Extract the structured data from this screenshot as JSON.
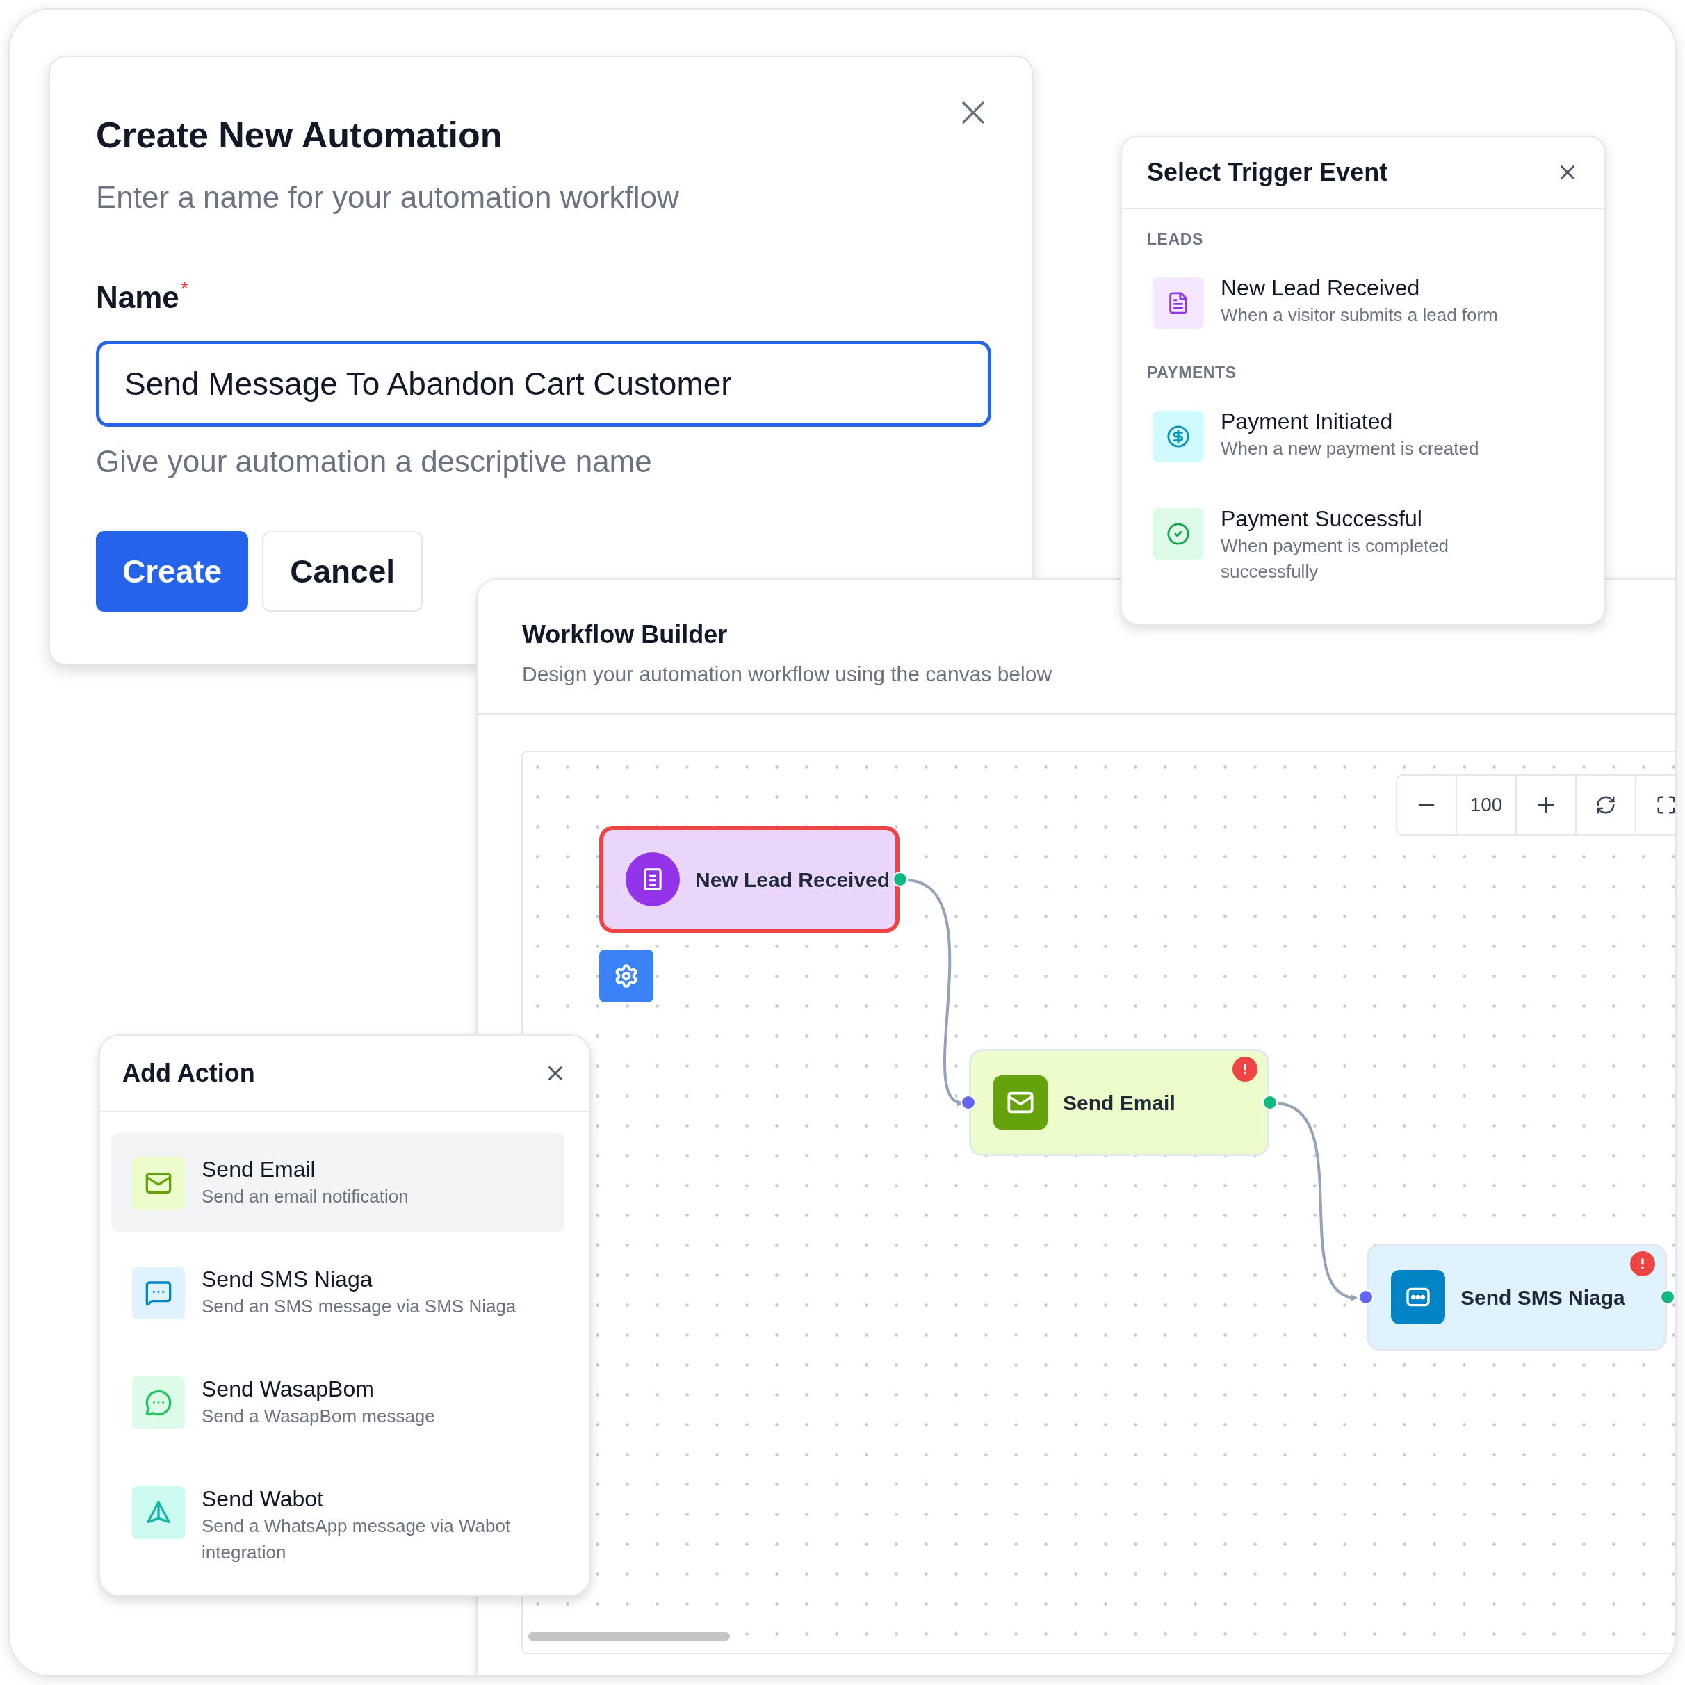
{
  "create_dialog": {
    "title": "Create New Automation",
    "subtitle": "Enter a name for your automation workflow",
    "field": {
      "label": "Name",
      "required_mark": "*",
      "value": "Send Message To Abandon Cart Customer",
      "hint": "Give your automation a descriptive name"
    },
    "buttons": [
      {
        "label": "Create",
        "kind": "primary"
      },
      {
        "label": "Cancel",
        "kind": "secondary"
      }
    ]
  },
  "trigger_panel": {
    "title": "Select Trigger Event",
    "groups": [
      {
        "heading": "LEADS",
        "items": [
          {
            "title": "New Lead Received",
            "description": "When a visitor submits a lead form",
            "kind": "form"
          }
        ]
      },
      {
        "heading": "PAYMENTS",
        "items": [
          {
            "title": "Payment Initiated",
            "description": "When a new payment is created",
            "kind": "payment"
          },
          {
            "title": "Payment Successful",
            "description": "When payment is completed successfully",
            "kind": "success"
          }
        ]
      }
    ]
  },
  "workflow": {
    "title": "Workflow Builder",
    "subtitle": "Design your automation workflow using the canvas below",
    "zoom": "100",
    "nodes": [
      {
        "label": "New Lead Received",
        "kind": "trigger",
        "selected": true,
        "error": false
      },
      {
        "label": "Send Email",
        "kind": "email",
        "selected": false,
        "error": true
      },
      {
        "label": "Send SMS Niaga",
        "kind": "sms",
        "selected": false,
        "error": true
      }
    ]
  },
  "add_action": {
    "title": "Add Action",
    "items": [
      {
        "title": "Send Email",
        "description": "Send an email notification",
        "kind": "email",
        "selected": true
      },
      {
        "title": "Send SMS Niaga",
        "description": "Send an SMS message via SMS Niaga",
        "kind": "sms",
        "selected": false
      },
      {
        "title": "Send WasapBom",
        "description": "Send a WasapBom message",
        "kind": "chat",
        "selected": false
      },
      {
        "title": "Send Wabot",
        "description": "Send a WhatsApp message via Wabot integration",
        "kind": "wabot",
        "selected": false
      }
    ]
  }
}
